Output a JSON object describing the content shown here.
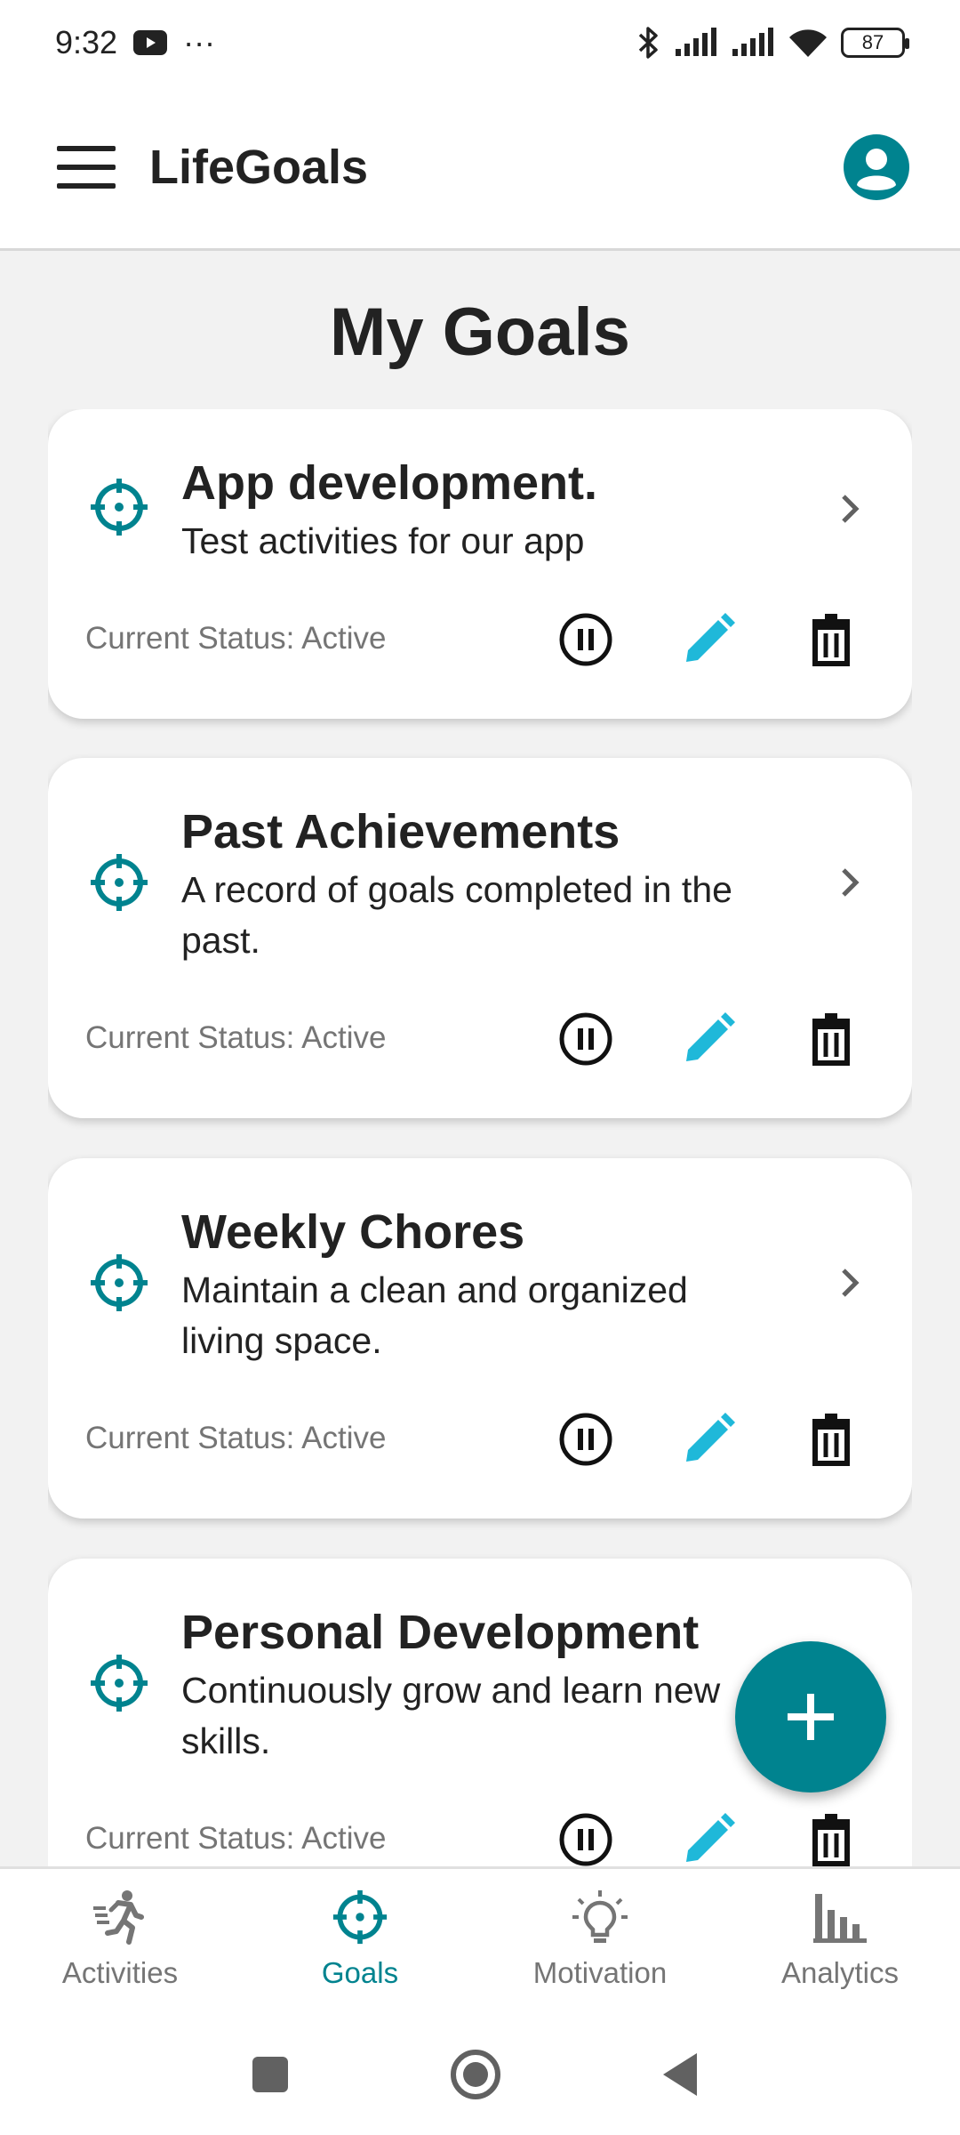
{
  "status_bar": {
    "time": "9:32",
    "dots": "···",
    "battery": "87"
  },
  "app_bar": {
    "title": "LifeGoals"
  },
  "page": {
    "title": "My Goals"
  },
  "goals": [
    {
      "title": "App development.",
      "description": "Test activities for our app",
      "status": "Current Status: Active"
    },
    {
      "title": "Past Achievements",
      "description": "A record of goals completed in the past.",
      "status": "Current Status: Active"
    },
    {
      "title": "Weekly Chores",
      "description": "Maintain a clean and organized living space.",
      "status": "Current Status: Active"
    },
    {
      "title": "Personal Development",
      "description": "Continuously grow and learn new skills.",
      "status": "Current Status: Active"
    }
  ],
  "bottom_nav": {
    "items": [
      {
        "label": "Activities",
        "icon": "running-icon",
        "active": false
      },
      {
        "label": "Goals",
        "icon": "target-icon",
        "active": true
      },
      {
        "label": "Motivation",
        "icon": "lightbulb-icon",
        "active": false
      },
      {
        "label": "Analytics",
        "icon": "bar-chart-icon",
        "active": false
      }
    ]
  },
  "colors": {
    "accent": "#00838f",
    "edit": "#1fb8d9",
    "text": "#222222",
    "muted": "#757575"
  }
}
